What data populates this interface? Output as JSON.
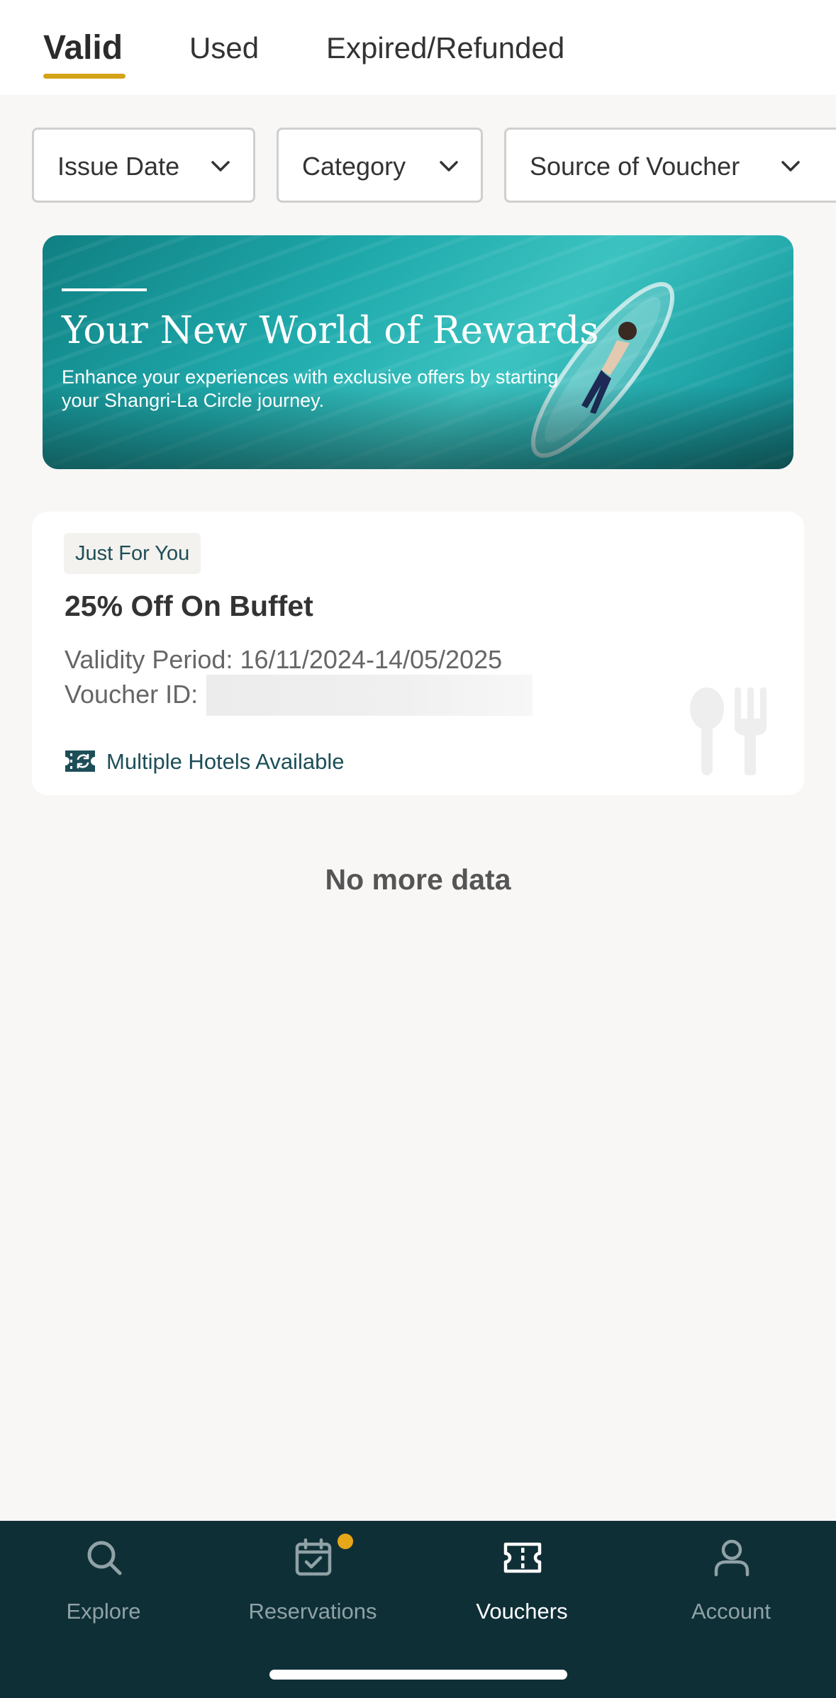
{
  "tabs": {
    "items": [
      {
        "label": "Valid",
        "active": true
      },
      {
        "label": "Used",
        "active": false
      },
      {
        "label": "Expired/Refunded",
        "active": false
      }
    ],
    "accent_color": "#d4a419"
  },
  "filters": [
    {
      "label": "Issue Date",
      "icon": "chevron-down-icon"
    },
    {
      "label": "Category",
      "icon": "chevron-down-icon"
    },
    {
      "label": "Source of Voucher",
      "icon": "chevron-down-icon"
    }
  ],
  "banner": {
    "title": "Your New World of Rewards",
    "subtitle": "Enhance your experiences with exclusive offers by starting your Shangri-La Circle journey."
  },
  "voucher": {
    "badge": "Just For You",
    "title": "25% Off On Buffet",
    "validity": "Validity Period: 16/11/2024-14/05/2025",
    "id_label": "Voucher ID:",
    "hotels": "Multiple Hotels Available",
    "hotels_icon": "ticket-swap-icon",
    "category_icon": "cutlery-icon"
  },
  "list_end": "No more data",
  "bottom_nav": {
    "items": [
      {
        "label": "Explore",
        "icon": "search-icon",
        "active": false
      },
      {
        "label": "Reservations",
        "icon": "calendar-check-icon",
        "active": false,
        "notification": true
      },
      {
        "label": "Vouchers",
        "icon": "voucher-icon",
        "active": true
      },
      {
        "label": "Account",
        "icon": "person-icon",
        "active": false
      }
    ],
    "background": "#0f2f37",
    "notification_color": "#e6a719"
  }
}
